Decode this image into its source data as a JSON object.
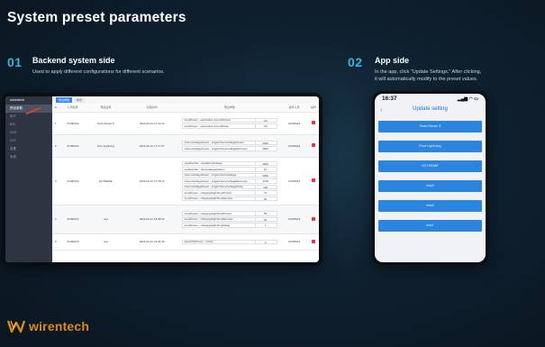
{
  "page": {
    "title": "System preset parameters"
  },
  "sections": [
    {
      "number": "01",
      "title": "Backend system side",
      "desc": "Used to apply different configurations for different scenarios."
    },
    {
      "number": "02",
      "title": "App side",
      "desc_line1": "In the app, click \"Update Settings.\" After clicking,",
      "desc_line2": "it will automatically modify to the preset values."
    }
  ],
  "laptop": {
    "sidebar": [
      {
        "label": "wirentech",
        "type": "head"
      },
      {
        "label": "预设参数",
        "type": "active"
      },
      {
        "label": "BDT"
      },
      {
        "label": "BSL"
      },
      {
        "label": "CDS"
      },
      {
        "label": "CST"
      },
      {
        "label": "设置"
      },
      {
        "label": "系统"
      }
    ],
    "tabs": [
      "预设参数",
      "新增"
    ],
    "columns": [
      "ID",
      "公司名称",
      "预设名称",
      "创建时间",
      "预设参数",
      "操作人员",
      "操作"
    ],
    "rows": [
      {
        "id": "1",
        "company": "OOMMA3",
        "name": "Tesla Model S",
        "time": "2024-03-12 17:16:11",
        "params": [
          {
            "k": "tempPower - electrodes currentProtect",
            "v": "-50"
          },
          {
            "k": "tempPower - electrodes currentPulse",
            "v": "-60"
          }
        ],
        "op": "OOMMA3"
      },
      {
        "id": "2",
        "company": "OOMMA3",
        "name": "Ford Lightning",
        "time": "2024-03-12 17:17:07",
        "params": [
          {
            "k": "chemoVoltagePower - singleChemoVoltagePower",
            "v": "3900"
          },
          {
            "k": "chemoVoltagePower - singleChemoVoltageRecovery",
            "v": "3800"
          }
        ],
        "op": "OOMMA3"
      },
      {
        "id": "3",
        "company": "OOMMA3",
        "name": "EXTREME",
        "time": "2024-03-12 17:18:13",
        "params": [
          {
            "k": "equalizeSet - equalizingVoltage",
            "v": "3900"
          },
          {
            "k": "equalizeSet - devicesEqualization",
            "v": "10"
          },
          {
            "k": "chemoVoltagePower - singleChemoVoltage",
            "v": "3900"
          },
          {
            "k": "chemoVoltagePower - singleChemoVoltageRecovery",
            "v": "3700"
          },
          {
            "k": "chemoVoltagePower - singleChemoVoltageDelay",
            "v": "100"
          },
          {
            "k": "tempPower - chargingHighTempProtect",
            "v": "70"
          },
          {
            "k": "tempPower - chargingHighTempRecover",
            "v": "60"
          }
        ],
        "op": "OOMMA3"
      },
      {
        "id": "4",
        "company": "OOMMA3",
        "name": "test",
        "time": "2024-03-12 18:38:14",
        "params": [
          {
            "k": "tempPower - chargingHighTempProtect",
            "v": "55"
          },
          {
            "k": "tempPower - chargingHighTempRecover",
            "v": "50"
          },
          {
            "k": "tempPower - chargingHighTempDelay",
            "v": "1"
          }
        ],
        "op": "OOMMA3"
      },
      {
        "id": "5",
        "company": "OOMMA3",
        "name": "test",
        "time": "2024-03-12 18:41:33",
        "params": [
          {
            "k": "electricityPower - config",
            "v": "0"
          }
        ],
        "op": "OOMMA3"
      }
    ]
  },
  "phone": {
    "time": "16:37",
    "status_icons": "▂▄▆ ◠ ▭",
    "back": "‹",
    "title": "Update setting",
    "buttons": [
      "Tesla Model S",
      "Ford Lightning",
      "EXTREME",
      "test3",
      "test3",
      "test1"
    ]
  },
  "logo": {
    "text": "wirentech"
  },
  "colors": {
    "accent": "#35b6e0",
    "button": "#2b85df",
    "logo": "#d9891a",
    "delete": "#e53935"
  }
}
